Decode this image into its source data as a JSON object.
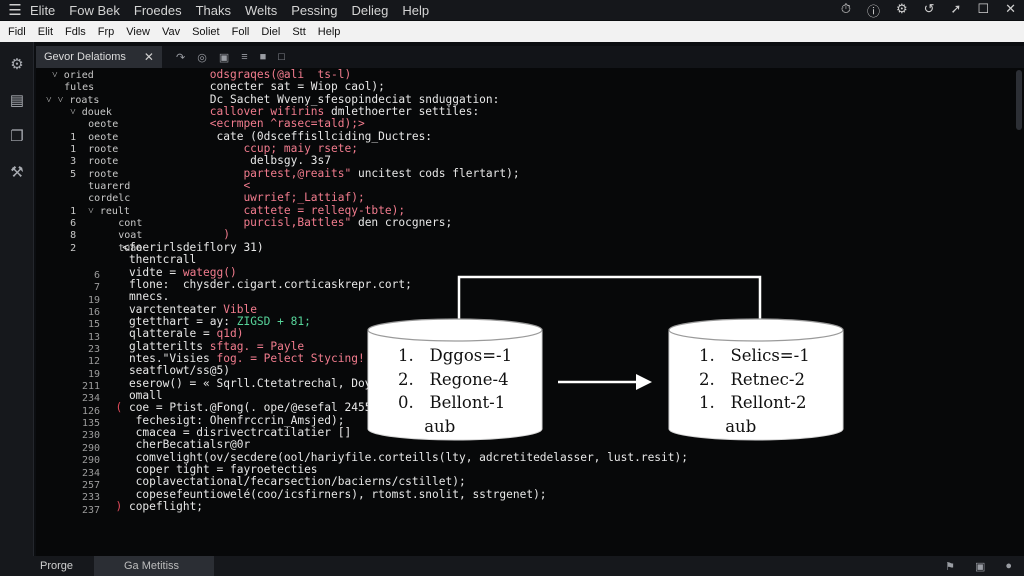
{
  "titlebar": {
    "menu": [
      "Elite",
      "Fow Bek",
      "Froedes",
      "Thaks",
      "Welts",
      "Pessing",
      "Delieg",
      "Help"
    ],
    "window_controls": [
      "⏱",
      "ⓘ",
      "⚙",
      "↺",
      "➚",
      "☐",
      "✕"
    ]
  },
  "menubar2": [
    "Fidl",
    "Elit",
    "Fdls",
    "Frp",
    "View",
    "Vav",
    "Soliet",
    "Foll",
    "Diel",
    "Stt",
    "Help"
  ],
  "activity_icons": [
    "gear-icon",
    "file-icon",
    "panel-icon",
    "tool-icon"
  ],
  "activity_glyphs": [
    "⚙",
    "▤",
    "❐",
    "⚒"
  ],
  "tab": {
    "label": "Gevor Delatioms",
    "close": "✕"
  },
  "tabtools": [
    "↷",
    "◎",
    "▣",
    "≡",
    "■",
    "□"
  ],
  "tree": [
    "  ˅ oried",
    "    fules",
    " ˅ ˅ roats",
    "     ˅ douek",
    "        oeote",
    "     1  oeote",
    "     1  roote",
    "     3  roote",
    "     5  roote",
    "        tuarerd",
    "        cordelc",
    "     1  ˅ reult",
    "     6       cont",
    "     8       voat",
    "     2       tuae"
  ],
  "gutter": [
    "6",
    "7",
    "19",
    "16",
    "15",
    "13",
    "23",
    "12",
    "19",
    "211",
    "234",
    "126",
    "135",
    "230",
    "290",
    "290",
    "234",
    "257",
    "233",
    "237"
  ],
  "code_lines": [
    [
      [
        "pink",
        "                odsgraqes(@ali  ts-l)"
      ]
    ],
    [
      [
        "white",
        "                conecter sat = Wiop caol);"
      ]
    ],
    [
      [
        "white",
        "                Dc Sachet Wveny_sfesopindeciat snduggation:"
      ]
    ],
    [
      [
        "pink",
        "                callover wifirins "
      ],
      [
        "white",
        "dmlethoerter settiles:"
      ]
    ],
    [
      [
        "pink",
        "                <ecrmpen ^rasec=tald);>"
      ]
    ],
    [
      [
        "white",
        "                 cate (0dsceffisllciding_Ductres:"
      ]
    ],
    [
      [
        "pink",
        "                     ccup; maiy rsete;"
      ]
    ],
    [
      [
        "white",
        "                      delbsgy. 3s7"
      ]
    ],
    [
      [
        "pink",
        "                     partest,@reaits\" "
      ],
      [
        "white",
        "uncitest cods flertart);"
      ]
    ],
    [
      [
        "pink",
        "                     <"
      ]
    ],
    [
      [
        "pink",
        "                     uwrrief;_Lattiaf);"
      ]
    ],
    [
      [
        "pink",
        "                     cattete = relleqy-tbte);"
      ]
    ],
    [
      [
        "pink",
        "                     purcisl,Battles\" "
      ],
      [
        "white",
        "den crocgners;"
      ]
    ],
    [
      [
        "pink",
        "                  )"
      ]
    ],
    [
      [
        "white",
        "   <foerirlsdeiflory 31)"
      ]
    ],
    [
      [
        "white",
        "    thentcrall"
      ]
    ],
    [
      [
        "white",
        "    vidte = "
      ],
      [
        "pink",
        "wategg()"
      ]
    ],
    [
      [
        "white",
        "    flone:  chysder.cigart.corticaskrepr.cort;"
      ]
    ],
    [
      [
        "white",
        "    mnecs."
      ]
    ],
    [
      [
        "white",
        "    varctenteater "
      ],
      [
        "pink",
        "Vible"
      ]
    ],
    [
      [
        "white",
        "    gtetthart = ay: "
      ],
      [
        "green",
        "ZIGSD + 81;"
      ]
    ],
    [
      [
        "white",
        "    qlatterale = "
      ],
      [
        "pink",
        "q1d)"
      ]
    ],
    [
      [
        "white",
        "    glatterilts "
      ],
      [
        "pink",
        "sftag. = Payle"
      ]
    ],
    [
      [
        "white",
        "    ntes.\"Visies "
      ],
      [
        "pink",
        "fog. = Pelect Stycing!"
      ]
    ],
    [
      [
        "white",
        "    seatflowt/ss@5)"
      ]
    ],
    [
      [
        "white",
        "    eserow() = « Sqrll.Ctetatrechal, Doy\";"
      ]
    ],
    [
      [
        "white",
        "    omall"
      ]
    ],
    [
      [
        "red",
        "  ( "
      ],
      [
        "white",
        "coe = Ptist.@Fong(. ope/@esefal 2455)"
      ]
    ],
    [
      [
        "white",
        "     fechesigt: Ohenfrccrin_Amsjed);"
      ]
    ],
    [
      [
        "white",
        "     cmacea = disrivectrcatilatier []"
      ]
    ],
    [
      [
        "white",
        "     cherBecatialsr@0r"
      ]
    ],
    [
      [
        "white",
        "     comvelight(ov/secdere(ool/hariyfile.corteills(lty, adcretitedelasser, lust.resit);"
      ]
    ],
    [
      [
        "white",
        "     coper tight = fayroetecties"
      ]
    ],
    [
      [
        "white",
        "     coplavectational/fecarsection/bacierns/cstillet);"
      ]
    ],
    [
      [
        "white",
        "     copesefeuntiowelé(coo/icsfirners), rtomst.snolit, sstrgenet);"
      ]
    ],
    [
      [
        "red",
        "  ) "
      ],
      [
        "white",
        "copeflight;"
      ]
    ]
  ],
  "diagram": {
    "left_db": [
      "1.   Dggos=-1",
      "2.   Regone-4",
      "0.   Bellont-1",
      "     aub"
    ],
    "right_db": [
      "1.   Selics=-1",
      "2.   Retnec-2",
      "1.   Rellont-2",
      "     aub"
    ]
  },
  "statusbar": {
    "left": "Prorge",
    "tab": "Ga Metitiss",
    "icons": [
      "⚑",
      "▣",
      "●"
    ]
  }
}
